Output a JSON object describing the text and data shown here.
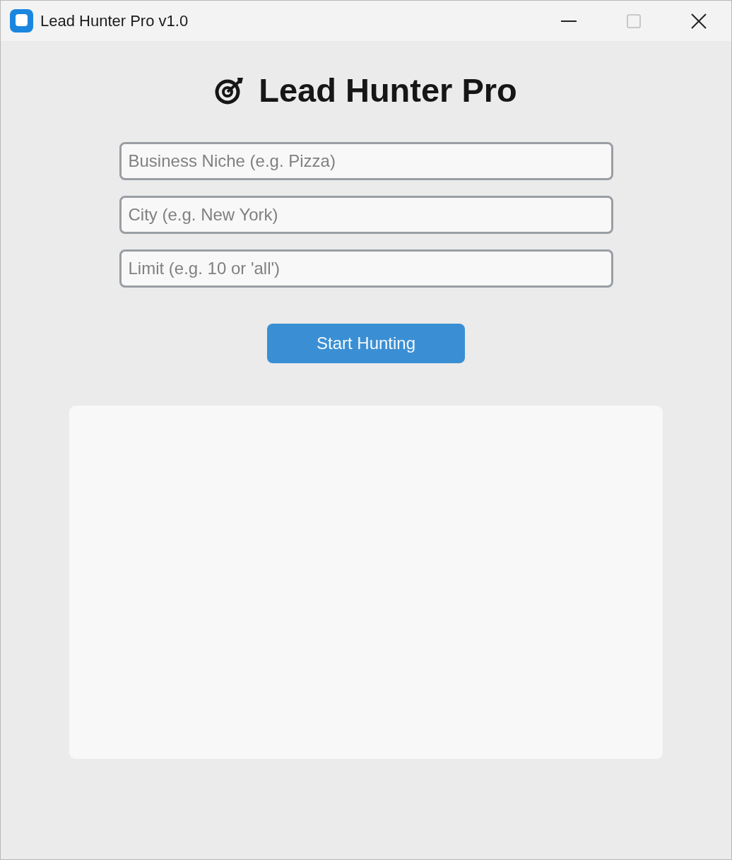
{
  "window": {
    "title": "Lead Hunter Pro v1.0"
  },
  "heading": "Lead Hunter Pro",
  "fields": [
    {
      "placeholder": "Business Niche (e.g. Pizza)"
    },
    {
      "placeholder": "City (e.g. New York)"
    },
    {
      "placeholder": "Limit (e.g. 10 or 'all')"
    }
  ],
  "button": "Start Hunting"
}
